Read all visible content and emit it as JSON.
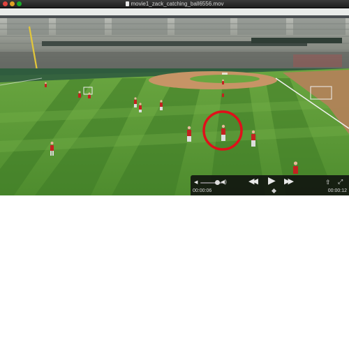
{
  "window": {
    "title": "movie1_zack_catching_ball6556.mov",
    "buttons": [
      "close",
      "minimize",
      "zoom"
    ]
  },
  "video": {
    "annotation": "red-circle-highlight",
    "colors": {
      "grass_light": "#5f9a3a",
      "grass_dark": "#3f7a28",
      "dirt": "#c0875a",
      "annotation": "#e0101a"
    }
  },
  "controls": {
    "elapsed_time": "00:00:06",
    "remaining_time": "00:00:12",
    "icons": {
      "volume_low": "speaker-low-icon",
      "volume_high": "speaker-high-icon",
      "rewind": "rewind-icon",
      "play": "play-icon",
      "fast_forward": "fast-forward-icon",
      "share": "share-icon",
      "fullscreen": "expand-icon"
    },
    "progress_fraction": 0.33,
    "volume_fraction": 0.8
  }
}
